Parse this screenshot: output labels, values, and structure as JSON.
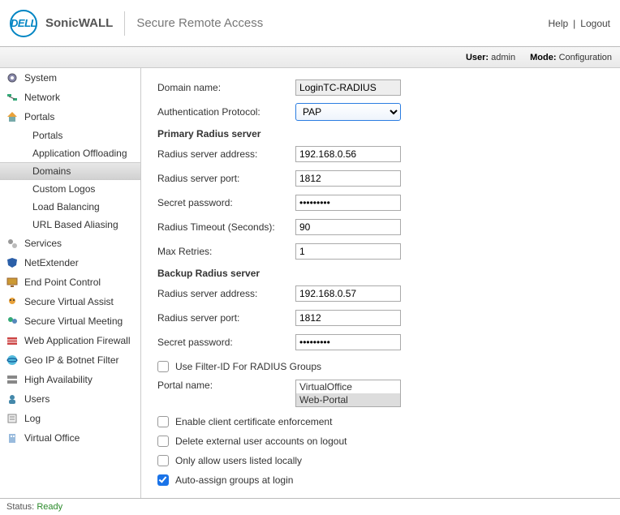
{
  "header": {
    "logo_text": "DELL",
    "brand": "SonicWALL",
    "product": "Secure Remote Access",
    "help": "Help",
    "logout": "Logout"
  },
  "subbar": {
    "user_label": "User:",
    "user_value": "admin",
    "mode_label": "Mode:",
    "mode_value": "Configuration"
  },
  "sidebar": {
    "items": [
      {
        "label": "System"
      },
      {
        "label": "Network"
      },
      {
        "label": "Portals",
        "children": [
          {
            "label": "Portals"
          },
          {
            "label": "Application Offloading"
          },
          {
            "label": "Domains",
            "selected": true
          },
          {
            "label": "Custom Logos"
          },
          {
            "label": "Load Balancing"
          },
          {
            "label": "URL Based Aliasing"
          }
        ]
      },
      {
        "label": "Services"
      },
      {
        "label": "NetExtender"
      },
      {
        "label": "End Point Control"
      },
      {
        "label": "Secure Virtual Assist"
      },
      {
        "label": "Secure Virtual Meeting"
      },
      {
        "label": "Web Application Firewall"
      },
      {
        "label": "Geo IP & Botnet Filter"
      },
      {
        "label": "High Availability"
      },
      {
        "label": "Users"
      },
      {
        "label": "Log"
      },
      {
        "label": "Virtual Office"
      }
    ]
  },
  "form": {
    "domain_name_label": "Domain name:",
    "domain_name_value": "LoginTC-RADIUS",
    "auth_proto_label": "Authentication Protocol:",
    "auth_proto_value": "PAP",
    "primary_header": "Primary Radius server",
    "radius_addr_label": "Radius server address:",
    "primary_addr": "192.168.0.56",
    "radius_port_label": "Radius server port:",
    "primary_port": "1812",
    "secret_label": "Secret password:",
    "primary_secret": "•••••••••",
    "timeout_label": "Radius Timeout (Seconds):",
    "timeout_value": "90",
    "retries_label": "Max Retries:",
    "retries_value": "1",
    "backup_header": "Backup Radius server",
    "backup_addr": "192.168.0.57",
    "backup_port": "1812",
    "backup_secret": "•••••••••",
    "chk_filterid": "Use Filter-ID For RADIUS Groups",
    "portal_name_label": "Portal name:",
    "portal_opt1": "VirtualOffice",
    "portal_opt2": "Web-Portal",
    "chk_clientcert": "Enable client certificate enforcement",
    "chk_delext": "Delete external user accounts on logout",
    "chk_onlylocal": "Only allow users listed locally",
    "chk_autoassign": "Auto-assign groups at login"
  },
  "footer": {
    "status_label": "Status:",
    "status_value": "Ready"
  }
}
